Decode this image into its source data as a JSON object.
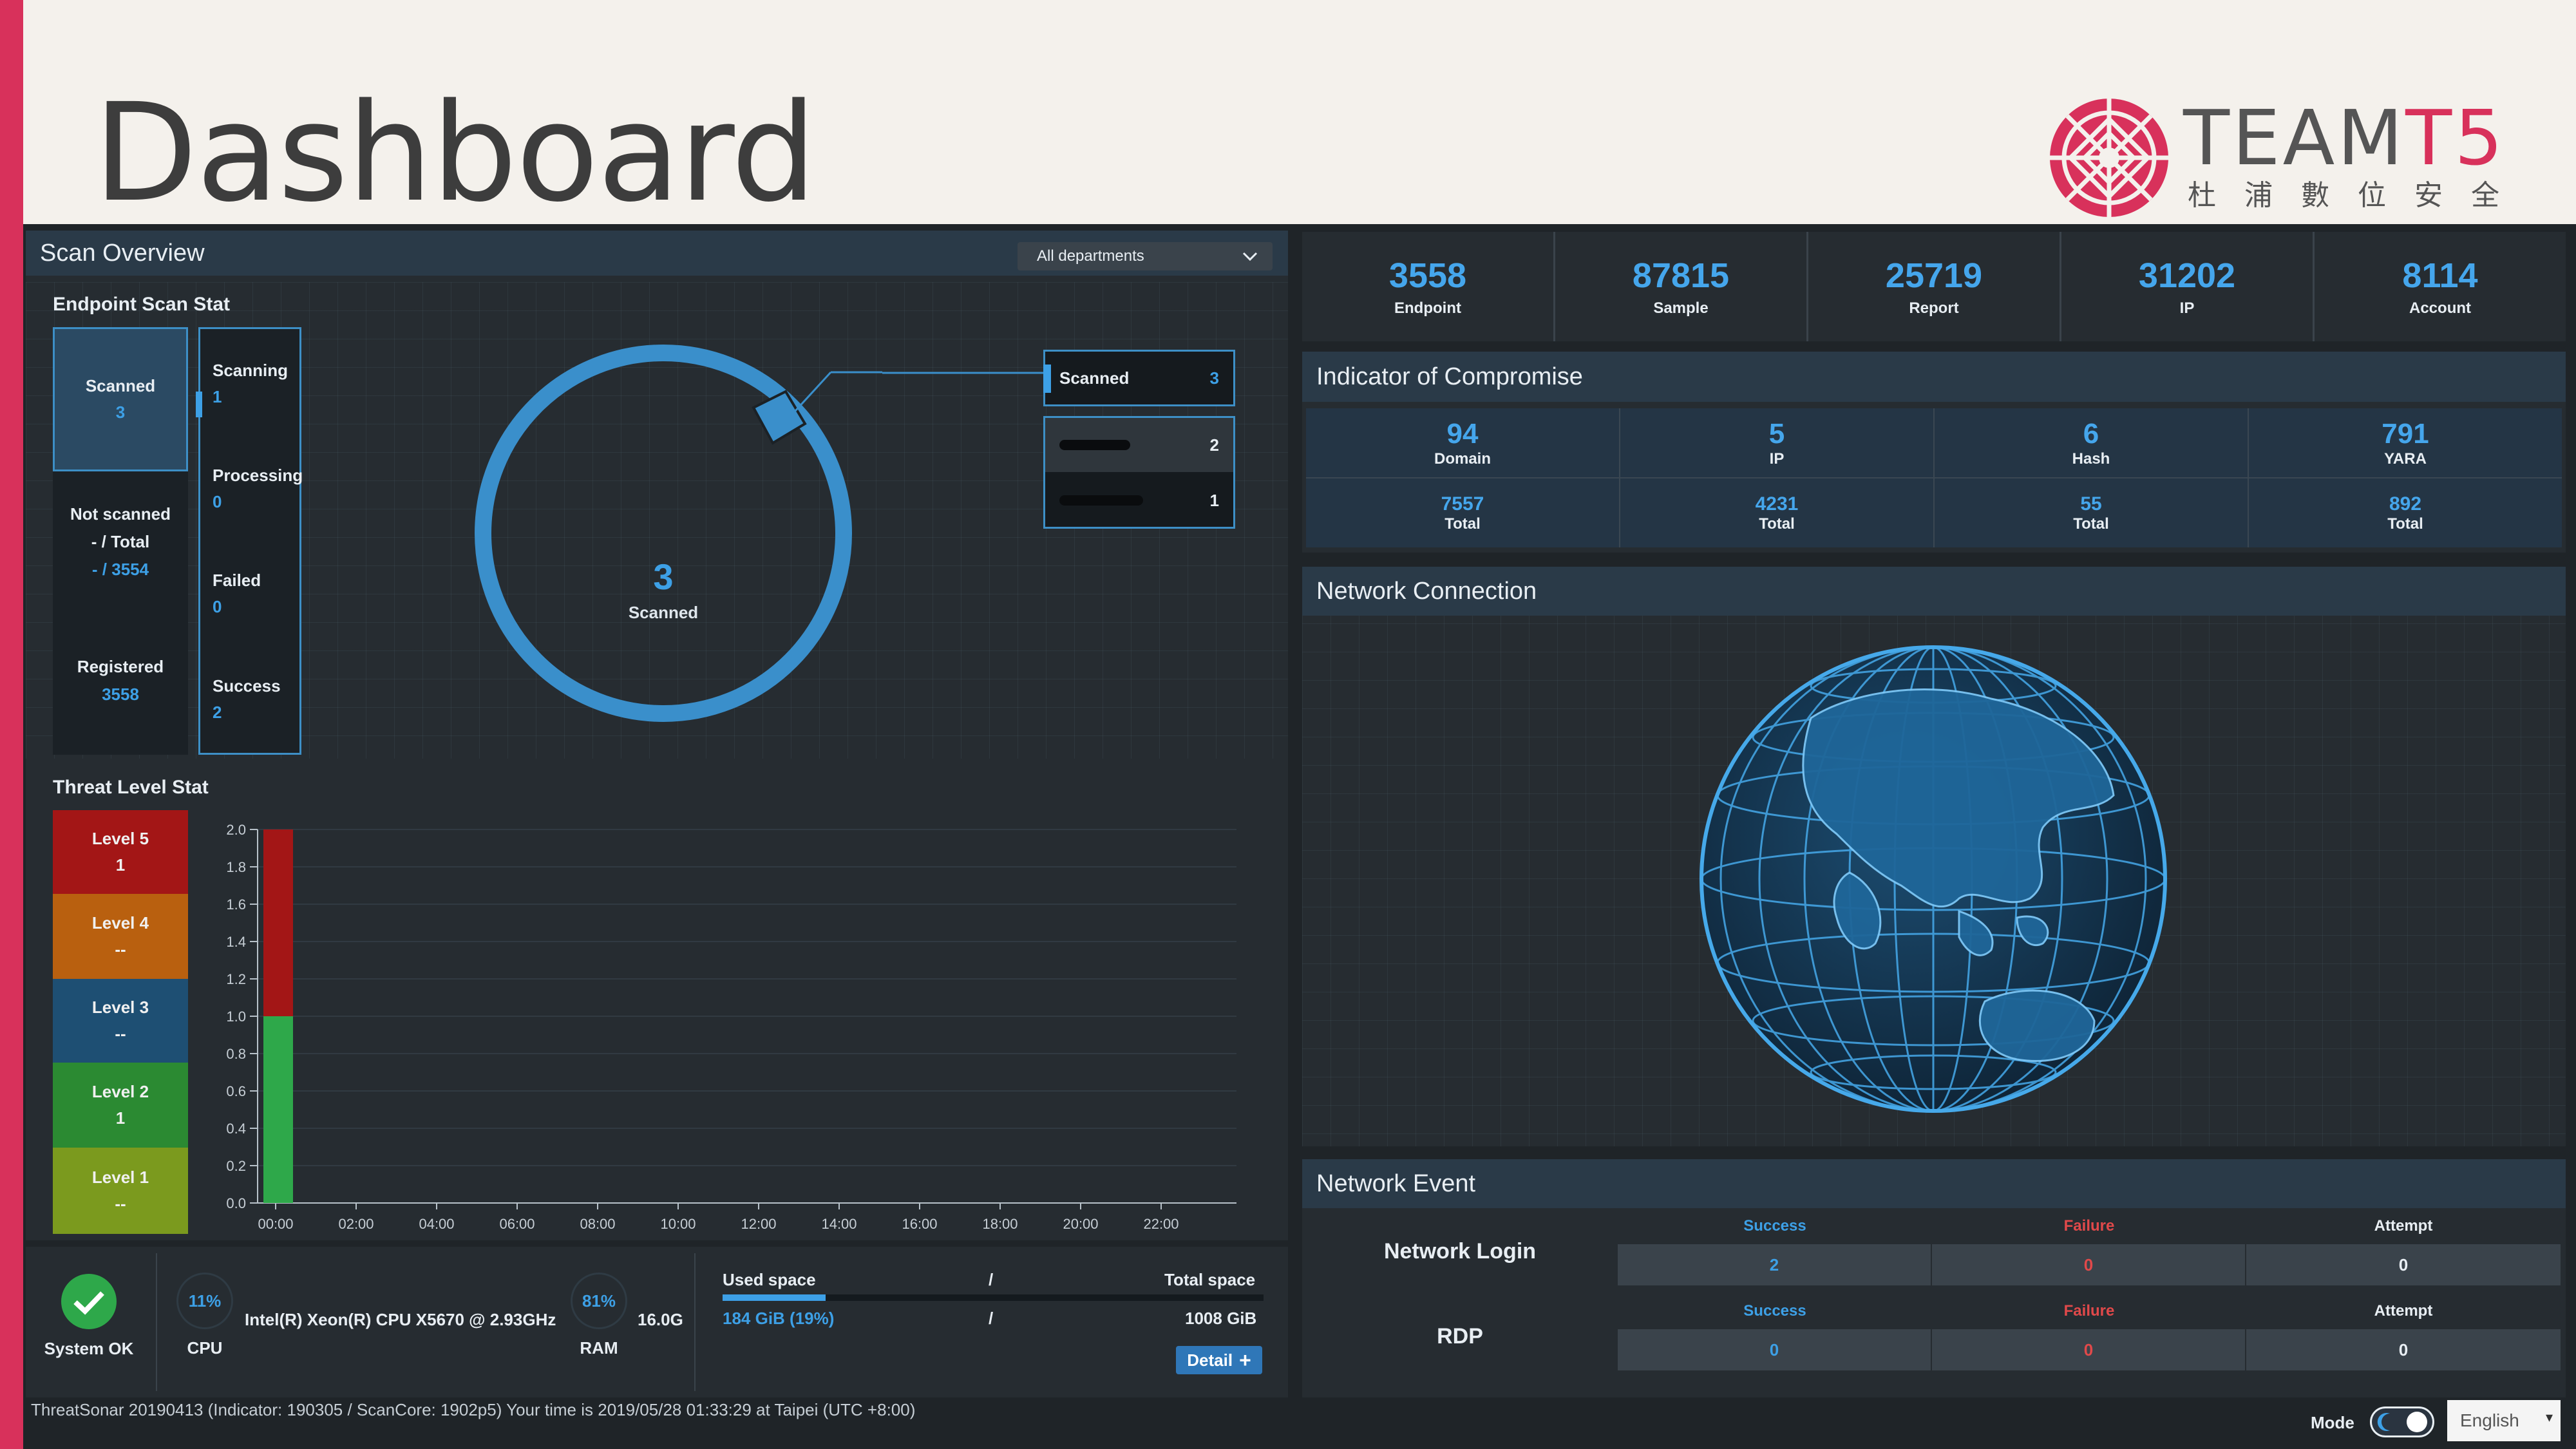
{
  "slide": {
    "title": "Dashboard",
    "logo_text_main": "TEAM",
    "logo_text_accent": "T5",
    "logo_sub": "杜浦數位安全"
  },
  "scan_overview": {
    "title": "Scan Overview",
    "department_select": "All departments",
    "endpoint_section_title": "Endpoint Scan Stat",
    "scanned_label": "Scanned",
    "scanned_value": "3",
    "not_scanned_label": "Not scanned",
    "not_scanned_total_label": "- / Total",
    "not_scanned_value": "- / 3554",
    "registered_label": "Registered",
    "registered_value": "3558",
    "scanning_label": "Scanning",
    "scanning_value": "1",
    "processing_label": "Processing",
    "processing_value": "0",
    "failed_label": "Failed",
    "failed_value": "0",
    "success_label": "Success",
    "success_value": "2",
    "donut_value": "3",
    "donut_label": "Scanned",
    "legend_scanned_label": "Scanned",
    "legend_scanned_value": "3",
    "legend_rows": [
      {
        "label": "",
        "value": "2"
      },
      {
        "label": "",
        "value": "1"
      }
    ]
  },
  "threat_level": {
    "title": "Threat Level Stat",
    "levels": [
      {
        "label": "Level 5",
        "value": "1",
        "color": "#a31616"
      },
      {
        "label": "Level 4",
        "value": "--",
        "color": "#b9600f"
      },
      {
        "label": "Level 3",
        "value": "--",
        "color": "#1e4f73"
      },
      {
        "label": "Level 2",
        "value": "1",
        "color": "#2b8a32"
      },
      {
        "label": "Level 1",
        "value": "--",
        "color": "#7b9a1e"
      }
    ]
  },
  "chart_data": {
    "type": "bar",
    "stacked": true,
    "categories": [
      "00:00",
      "02:00",
      "04:00",
      "06:00",
      "08:00",
      "10:00",
      "12:00",
      "14:00",
      "16:00",
      "18:00",
      "20:00",
      "22:00"
    ],
    "series": [
      {
        "values": [
          1,
          0,
          0,
          0,
          0,
          0,
          0,
          0,
          0,
          0,
          0,
          0
        ],
        "color": "#2ea84a"
      },
      {
        "values": [
          1,
          0,
          0,
          0,
          0,
          0,
          0,
          0,
          0,
          0,
          0,
          0
        ],
        "color": "#a31616"
      }
    ],
    "yticks": [
      "0.0",
      "0.2",
      "0.4",
      "0.6",
      "0.8",
      "1.0",
      "1.2",
      "1.4",
      "1.6",
      "1.8",
      "2.0"
    ],
    "ylim": [
      0,
      2
    ]
  },
  "system": {
    "status_label": "System OK",
    "cpu_pct": "11%",
    "cpu_label": "CPU",
    "cpu_model": "Intel(R) Xeon(R) CPU X5670 @ 2.93GHz",
    "ram_pct": "81%",
    "ram_label": "RAM",
    "ram_total": "16.0G",
    "used_space_label": "Used space",
    "used_space_value": "184 GiB (19%)",
    "used_space_fraction": 0.19,
    "slash": "/",
    "total_space_label": "Total space",
    "total_space_value": "1008 GiB",
    "detail_button": "Detail"
  },
  "kpis": [
    {
      "value": "3558",
      "label": "Endpoint"
    },
    {
      "value": "87815",
      "label": "Sample"
    },
    {
      "value": "25719",
      "label": "Report"
    },
    {
      "value": "31202",
      "label": "IP"
    },
    {
      "value": "8114",
      "label": "Account"
    }
  ],
  "ioc": {
    "title": "Indicator of Compromise",
    "items": [
      {
        "value": "94",
        "label": "Domain",
        "total": "7557",
        "total_label": "Total"
      },
      {
        "value": "5",
        "label": "IP",
        "total": "4231",
        "total_label": "Total"
      },
      {
        "value": "6",
        "label": "Hash",
        "total": "55",
        "total_label": "Total"
      },
      {
        "value": "791",
        "label": "YARA",
        "total": "892",
        "total_label": "Total"
      }
    ]
  },
  "network_connection": {
    "title": "Network Connection"
  },
  "network_event": {
    "title": "Network Event",
    "rows": [
      {
        "label": "Network Login",
        "success_label": "Success",
        "failure_label": "Failure",
        "attempt_label": "Attempt",
        "success": "2",
        "failure": "0",
        "attempt": "0"
      },
      {
        "label": "RDP",
        "success_label": "Success",
        "failure_label": "Failure",
        "attempt_label": "Attempt",
        "success": "0",
        "failure": "0",
        "attempt": "0"
      }
    ]
  },
  "footer": {
    "status_text": "ThreatSonar 20190413 (Indicator: 190305 / ScanCore: 1902p5) Your time is 2019/05/28 01:33:29 at Taipei (UTC +8:00)",
    "mode_label": "Mode",
    "language": "English"
  }
}
